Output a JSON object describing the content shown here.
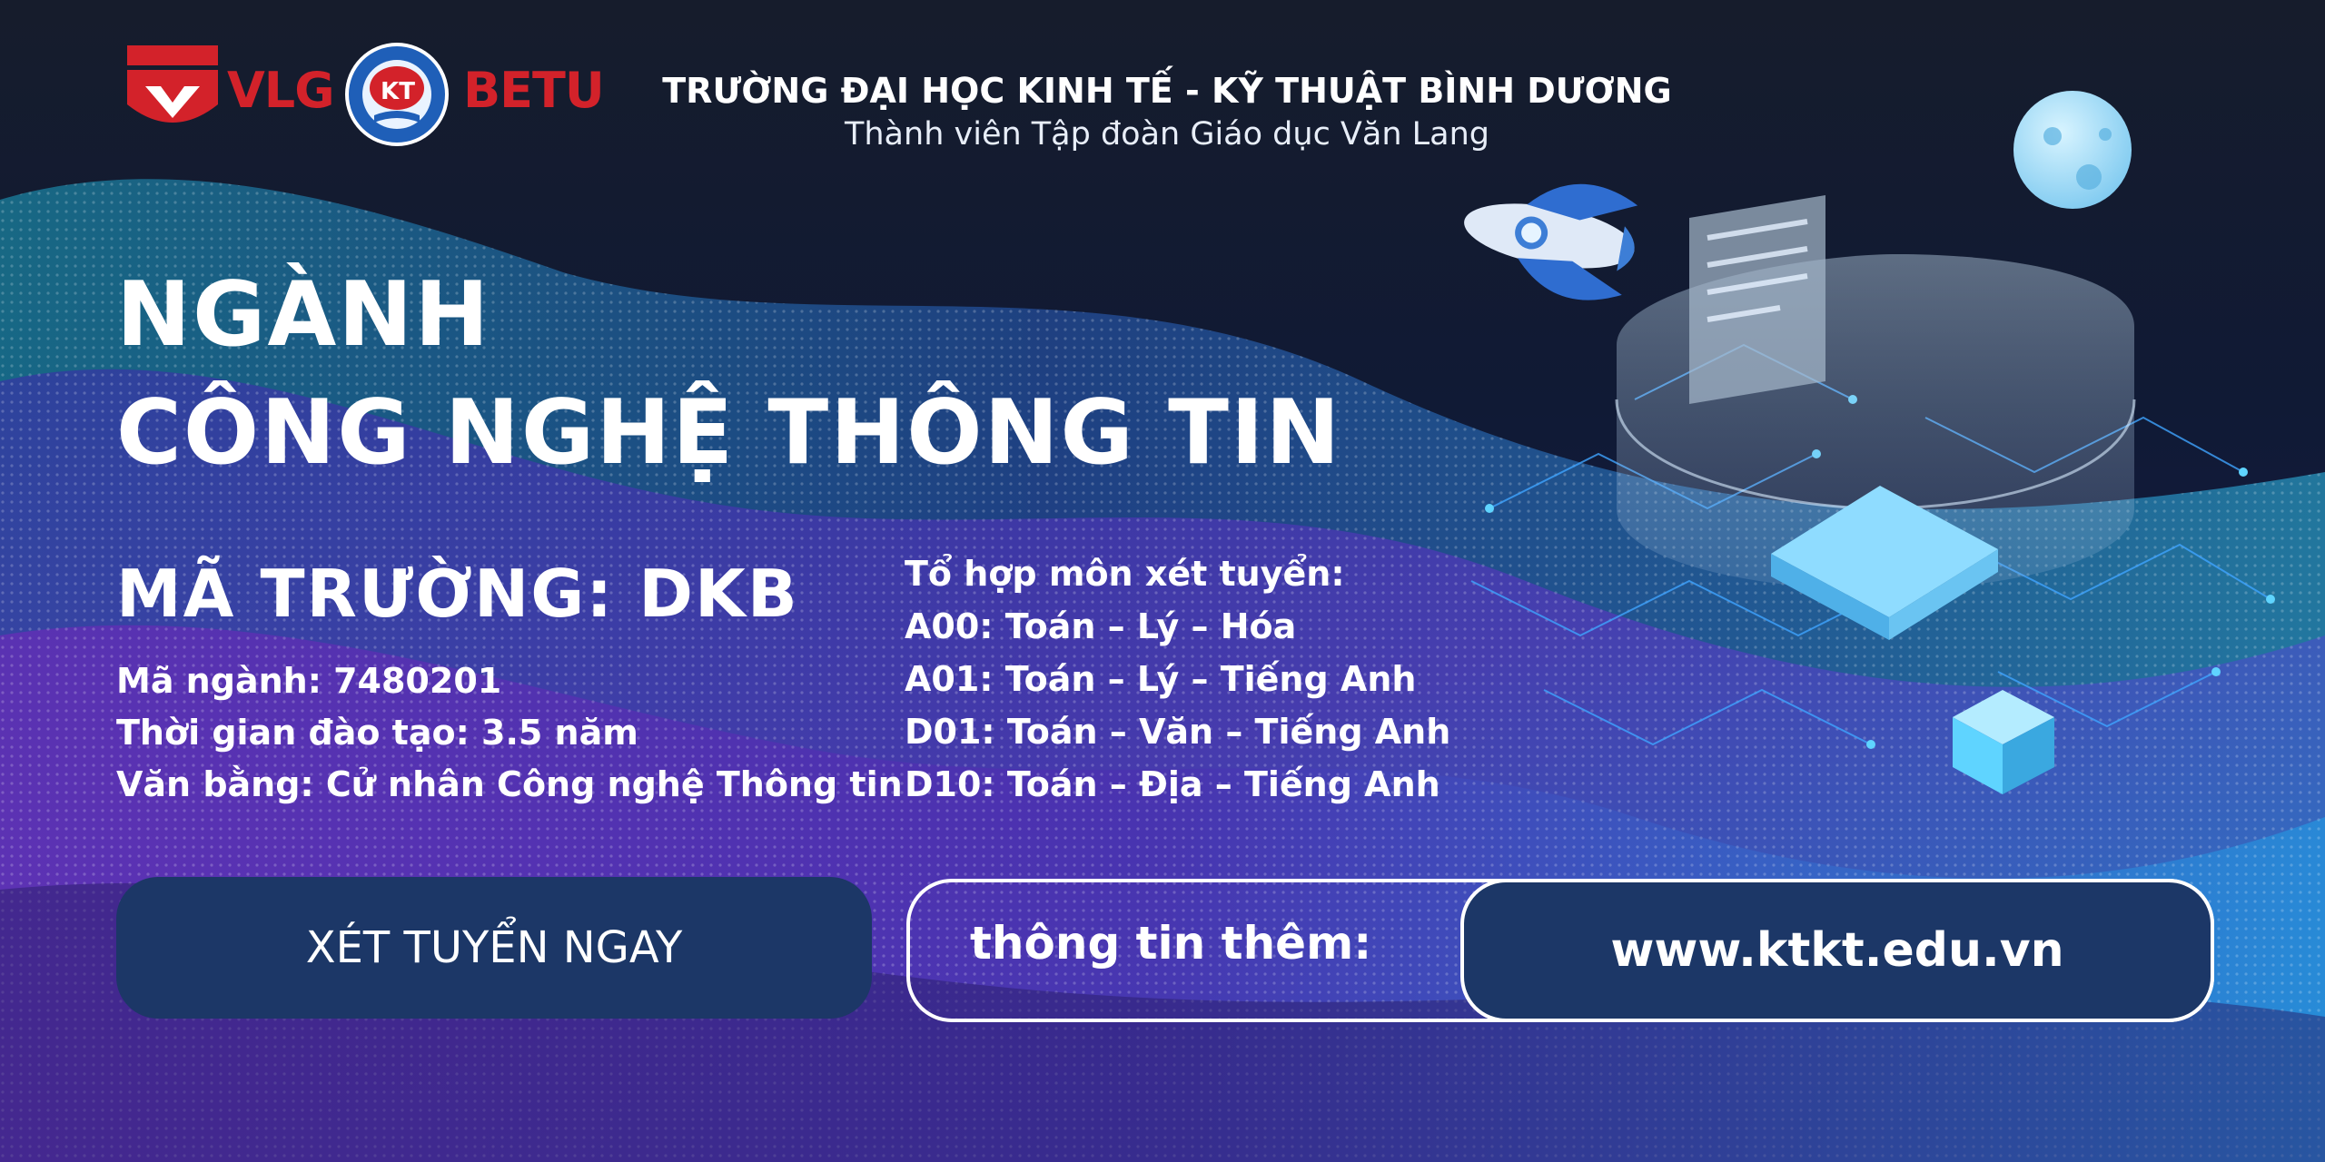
{
  "header": {
    "brand_left": "VLG",
    "brand_right": "BETU",
    "school_name": "TRƯỜNG ĐẠI HỌC KINH TẾ - KỸ THUẬT BÌNH DƯƠNG",
    "member_line": "Thành viên Tập đoàn Giáo dục Văn Lang",
    "seal_text": "KT"
  },
  "title": {
    "line1": "NGÀNH",
    "line2": "CÔNG NGHỆ THÔNG TIN"
  },
  "program": {
    "school_code": "MÃ TRƯỜNG: DKB",
    "major_code": "Mã ngành: 7480201",
    "duration": "Thời gian đào tạo: 3.5 năm",
    "degree": "Văn bằng: Cử nhân Công nghệ Thông tin"
  },
  "combinations": {
    "heading": "Tổ hợp môn xét tuyển:",
    "items": [
      "A00: Toán – Lý – Hóa",
      "A01: Toán – Lý – Tiếng Anh",
      "D01: Toán – Văn – Tiếng Anh",
      "D10: Toán – Địa – Tiếng Anh"
    ]
  },
  "cta": {
    "apply_label": "XÉT TUYỂN NGAY",
    "more_info_label": "thông tin thêm:",
    "url": "www.ktkt.edu.vn"
  },
  "colors": {
    "brand_red": "#d3222a",
    "button_navy": "#1c3767",
    "accent_cyan": "#5fd4ff",
    "accent_purple": "#7a3cc8"
  }
}
